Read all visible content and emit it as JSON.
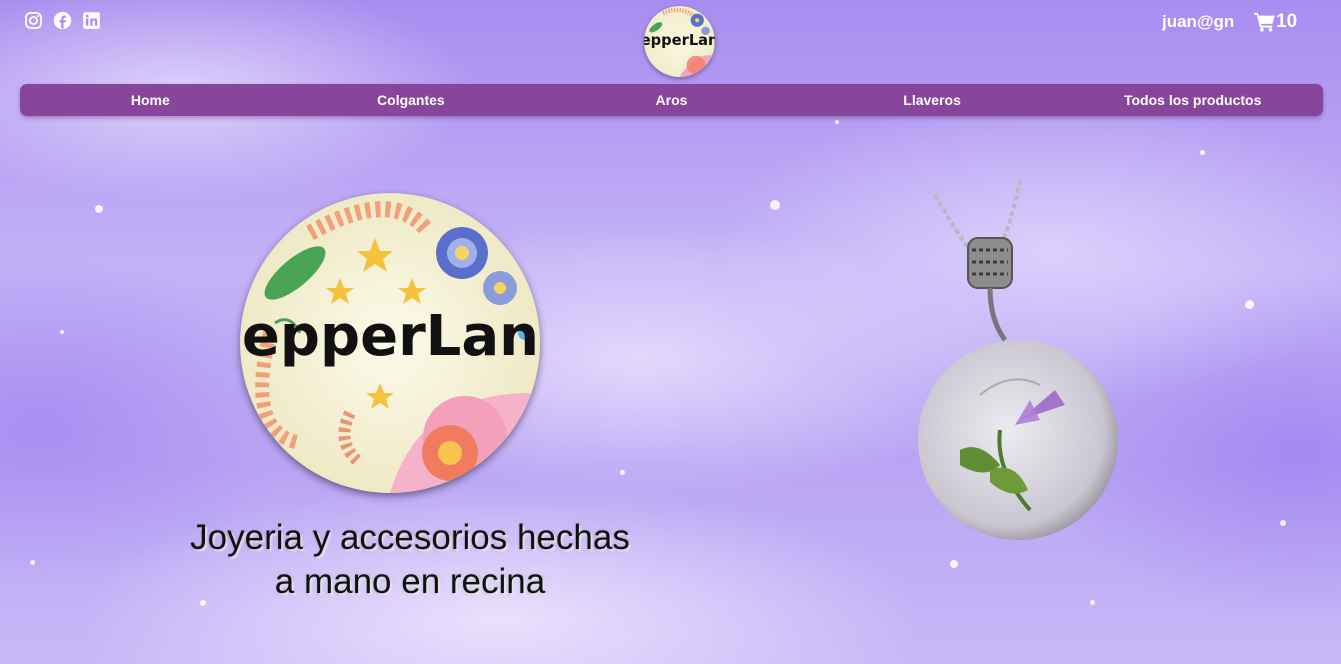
{
  "header": {
    "social_icons": [
      "instagram-icon",
      "facebook-icon",
      "linkedin-icon"
    ],
    "user_email": "juan@gn",
    "cart_count": "10"
  },
  "brand": {
    "logo_text": "PepperLand"
  },
  "nav": {
    "items": [
      "Home",
      "Colgantes",
      "Aros",
      "Llaveros",
      "Todos los productos"
    ]
  },
  "hero": {
    "tagline_line1": "Joyeria y accesorios hechas",
    "tagline_line2": "a mano en recina"
  },
  "colors": {
    "nav_bg": "#87469c",
    "text_white": "#ffffff"
  }
}
